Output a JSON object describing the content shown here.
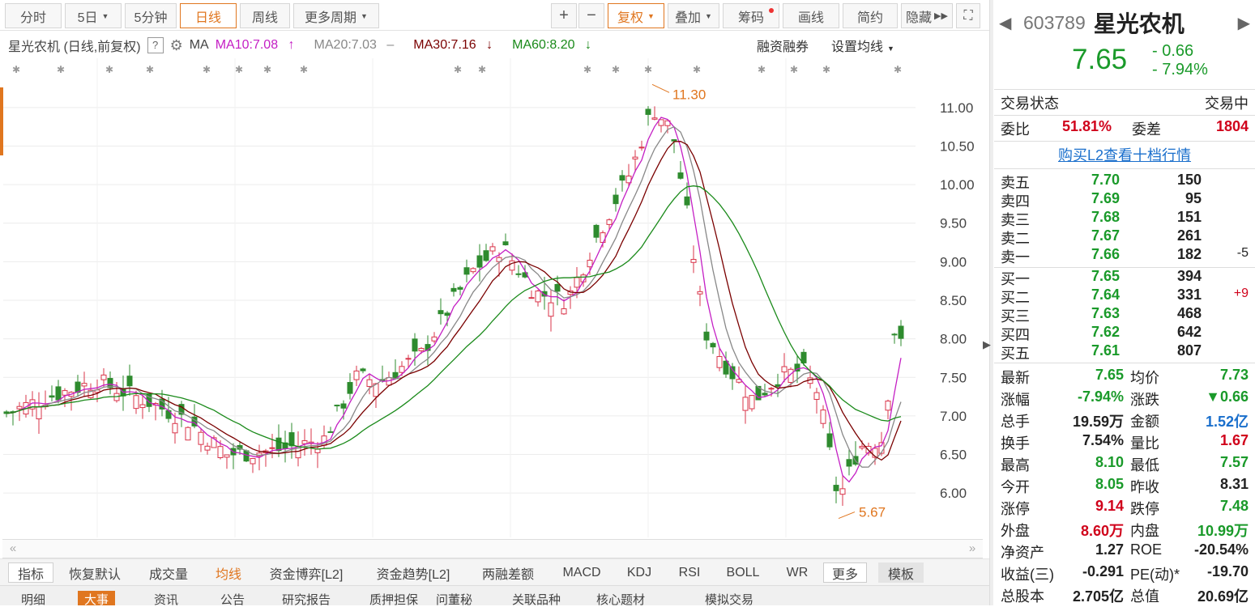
{
  "toolbar": {
    "tabs": [
      "分时",
      "5日",
      "5分钟",
      "日线",
      "周线",
      "更多周期"
    ],
    "tools": [
      "+",
      "−",
      "复权",
      "叠加",
      "筹码",
      "画线",
      "简约",
      "隐藏"
    ],
    "expand": "⛶"
  },
  "legend": {
    "title": "星光农机 (日线,前复权)",
    "help": "?",
    "ma": "MA",
    "ma10": "MA10:7.08",
    "ma10_arrow": "↑",
    "ma20": "MA20:7.03",
    "ma20_arrow": "–",
    "ma30": "MA30:7.16",
    "ma30_arrow": "↓",
    "ma60": "MA60:8.20",
    "ma60_arrow": "↓",
    "margin": "融资融券",
    "setma": "设置均线"
  },
  "chart_data": {
    "type": "candlestick",
    "y_ticks": [
      "11.00",
      "10.50",
      "10.00",
      "9.50",
      "9.00",
      "8.50",
      "8.00",
      "7.50",
      "7.00",
      "6.50",
      "6.00"
    ],
    "ylim": [
      5.55,
      11.45
    ],
    "annotations": {
      "high": "11.30",
      "low": "5.67"
    },
    "colors": {
      "up": "#d9344a",
      "down": "#2e8b2e",
      "ma10": "#c41fc4",
      "ma20": "#888888",
      "ma30": "#7a0000",
      "ma60": "#1a8a1a"
    }
  },
  "indicators": [
    "指标",
    "恢复默认",
    "成交量",
    "均线",
    "资金博弈[L2]",
    "资金趋势[L2]",
    "两融差额",
    "MACD",
    "KDJ",
    "RSI",
    "BOLL",
    "WR",
    "更多",
    "模板"
  ],
  "bottom_tabs": [
    "明细",
    "大事",
    "资讯",
    "公告",
    "研究报告",
    "质押担保",
    "问董秘",
    "关联品种",
    "核心题材",
    "模拟交易"
  ],
  "quote": {
    "code": "603789",
    "name": "星光农机",
    "price": "7.65",
    "change": "- 0.66",
    "pct": "- 7.94%",
    "status_label": "交易状态",
    "status": "交易中",
    "wb_label": "委比",
    "wb": "51.81%",
    "wc_label": "委差",
    "wc": "1804",
    "l2": "购买L2查看十档行情",
    "asks": [
      {
        "label": "卖五",
        "price": "7.70",
        "vol": "150",
        "chg": ""
      },
      {
        "label": "卖四",
        "price": "7.69",
        "vol": "95",
        "chg": ""
      },
      {
        "label": "卖三",
        "price": "7.68",
        "vol": "151",
        "chg": ""
      },
      {
        "label": "卖二",
        "price": "7.67",
        "vol": "261",
        "chg": ""
      },
      {
        "label": "卖一",
        "price": "7.66",
        "vol": "182",
        "chg": "-5"
      }
    ],
    "bids": [
      {
        "label": "买一",
        "price": "7.65",
        "vol": "394",
        "chg": ""
      },
      {
        "label": "买二",
        "price": "7.64",
        "vol": "331",
        "chg": "+9"
      },
      {
        "label": "买三",
        "price": "7.63",
        "vol": "468",
        "chg": ""
      },
      {
        "label": "买四",
        "price": "7.62",
        "vol": "642",
        "chg": ""
      },
      {
        "label": "买五",
        "price": "7.61",
        "vol": "807",
        "chg": ""
      }
    ],
    "stats": [
      {
        "l1": "最新",
        "v1": "7.65",
        "l2": "均价",
        "v2": "7.73"
      },
      {
        "l1": "涨幅",
        "v1": "-7.94%",
        "l2": "涨跌",
        "v2": "▼0.66"
      },
      {
        "l1": "总手",
        "v1": "19.59万",
        "l2": "金额",
        "v2": "1.52亿"
      },
      {
        "l1": "换手",
        "v1": "7.54%",
        "l2": "量比",
        "v2": "1.67"
      },
      {
        "l1": "最高",
        "v1": "8.10",
        "l2": "最低",
        "v2": "7.57"
      },
      {
        "l1": "今开",
        "v1": "8.05",
        "l2": "昨收",
        "v2": "8.31"
      },
      {
        "l1": "涨停",
        "v1": "9.14",
        "l2": "跌停",
        "v2": "7.48"
      },
      {
        "l1": "外盘",
        "v1": "8.60万",
        "l2": "内盘",
        "v2": "10.99万"
      },
      {
        "l1": "净资产",
        "v1": "1.27",
        "l2": "ROE",
        "v2": "-20.54%"
      },
      {
        "l1": "收益(三)",
        "v1": "-0.291",
        "l2": "PE(动)*",
        "v2": "-19.70"
      },
      {
        "l1": "总股本",
        "v1": "2.705亿",
        "l2": "总值",
        "v2": "20.69亿"
      }
    ]
  }
}
